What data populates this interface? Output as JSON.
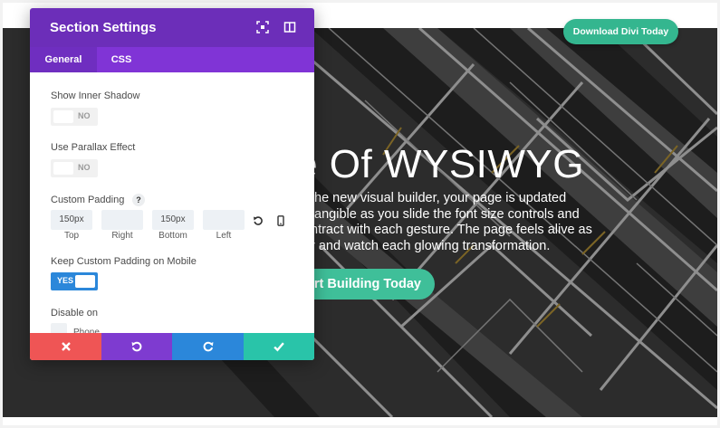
{
  "hero": {
    "title": "e Of WYSIWYG",
    "text_lines": [
      "the new visual builder, your page is updated",
      "tangible as you slide the font size controls and",
      "ntract with each gesture. The page feels alive as",
      "r and watch each glowing transformation."
    ],
    "cta_label": "art Building Today",
    "download_label": "Download Divi Today"
  },
  "modal": {
    "title": "Section Settings",
    "header_icons": [
      "focus-icon",
      "sidebar-icon"
    ],
    "tabs": [
      {
        "label": "General",
        "active": true
      },
      {
        "label": "CSS",
        "active": false
      }
    ],
    "show_inner_shadow": {
      "label": "Show Inner Shadow",
      "value": "NO"
    },
    "use_parallax": {
      "label": "Use Parallax Effect",
      "value": "NO"
    },
    "custom_padding": {
      "label": "Custom Padding",
      "help": "?",
      "fields": [
        {
          "label": "Top",
          "value": "150px"
        },
        {
          "label": "Right",
          "value": ""
        },
        {
          "label": "Bottom",
          "value": "150px"
        },
        {
          "label": "Left",
          "value": ""
        }
      ]
    },
    "keep_padding_mobile": {
      "label": "Keep Custom Padding on Mobile",
      "value": "YES"
    },
    "disable_on": {
      "label": "Disable on",
      "option": "Phone"
    },
    "footer": {
      "colors": {
        "cancel": "#ef5555",
        "undo": "#7e3bd0",
        "redo": "#2b87da",
        "save": "#29c4a9"
      }
    }
  },
  "colors": {
    "header_purple": "#6c2eb9",
    "tabs_purple": "#8034d6",
    "accent_green": "#3fbf99",
    "toggle_blue": "#2b87da"
  }
}
